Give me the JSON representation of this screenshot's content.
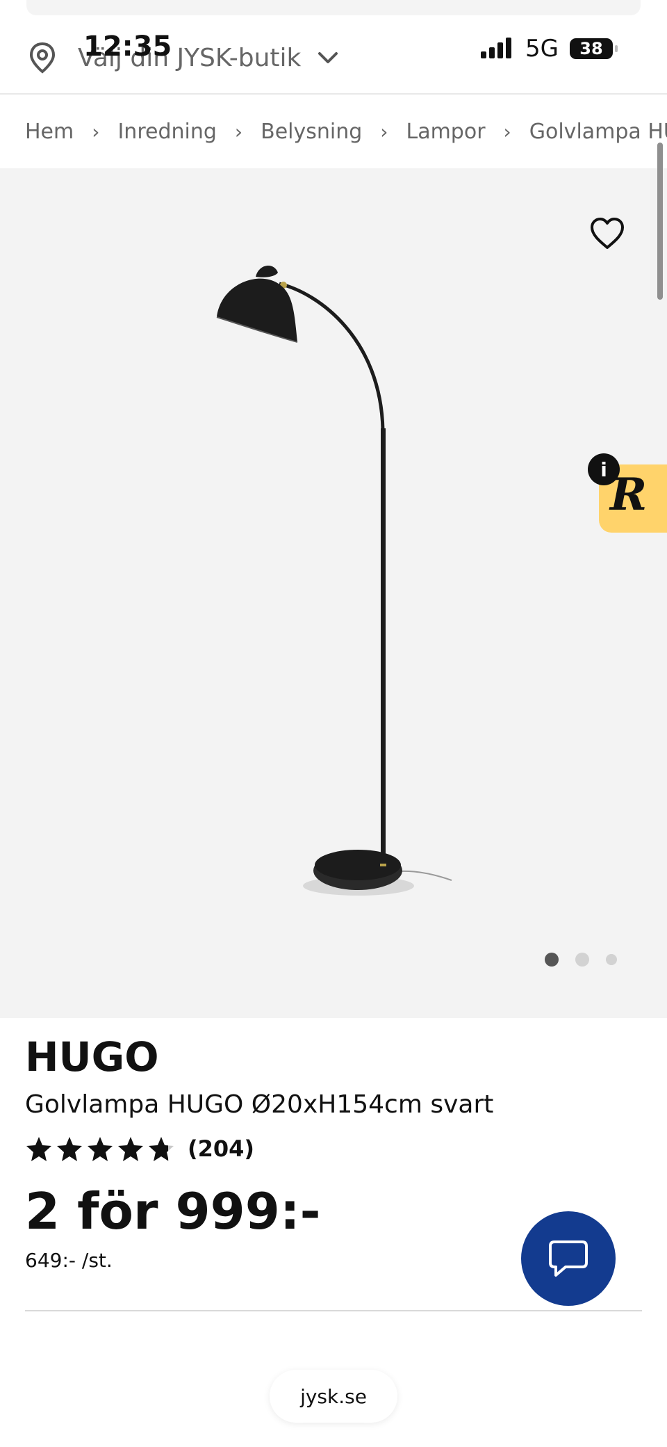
{
  "status_bar": {
    "time": "12:35",
    "network": "5G",
    "battery": "38"
  },
  "header": {
    "store_select_label": "Välj din JYSK-butik"
  },
  "breadcrumb": [
    "Hem",
    "Inredning",
    "Belysning",
    "Lampor",
    "Golvlampa HUGO"
  ],
  "gallery": {
    "image_count": 3,
    "active_index": 0
  },
  "rating_badge": {
    "letter": "R",
    "info": "i"
  },
  "product": {
    "brand": "HUGO",
    "name": "Golvlampa HUGO Ø20xH154cm svart",
    "rating": 4.8,
    "rating_count": "(204)",
    "price": "2 för 999:-",
    "unit_price": "649:- /st."
  },
  "browser": {
    "url": "jysk.se"
  },
  "colors": {
    "brand_blue": "#133b8f",
    "badge_yellow": "#ffd36b",
    "gallery_bg": "#f3f3f3"
  },
  "icons": [
    "location-pin-icon",
    "chevron-down-icon",
    "signal-icon",
    "heart-icon",
    "star-icon",
    "chat-bubble-icon"
  ]
}
